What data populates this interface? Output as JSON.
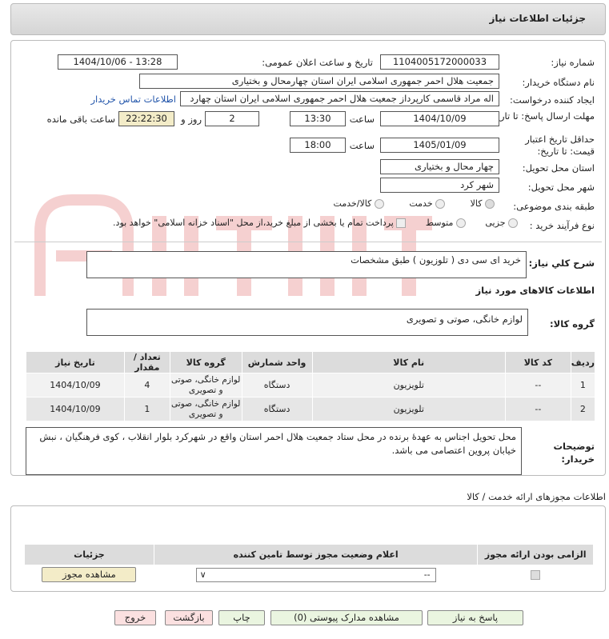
{
  "header": {
    "title": "جزئیات اطلاعات نیاز"
  },
  "fields": {
    "need_number_label": "شماره نیاز:",
    "need_number": "1104005172000033",
    "announce_label": "تاریخ و ساعت اعلان عمومی:",
    "announce_value": "1404/10/06 - 13:28",
    "buyer_org_label": "نام دستگاه خریدار:",
    "buyer_org": "جمعیت هلال احمر جمهوری اسلامی ایران استان چهارمحال و بختیاری",
    "creator_label": "ایجاد کننده درخواست:",
    "creator": "اله مراد قاسمی کارپرداز جمعیت هلال احمر جمهوری اسلامی ایران استان چهارد",
    "contact_link": "اطلاعات تماس خریدار",
    "deadline_label": "مهلت ارسال پاسخ: تا تاریخ:",
    "deadline_date": "1404/10/09",
    "time_label": "ساعت",
    "deadline_time": "13:30",
    "days_value": "2",
    "days_label": "روز و",
    "remaining_time": "22:22:30",
    "remaining_label": "ساعت باقی مانده",
    "validity_label": "حداقل تاریخ اعتبار قیمت: تا تاریخ:",
    "validity_date": "1405/01/09",
    "validity_time": "18:00",
    "province_label": "استان محل تحویل:",
    "province": "چهار محال و بختیاری",
    "city_label": "شهر محل تحویل:",
    "city": "شهر کرد",
    "category_label": "طبقه بندی موضوعی:",
    "category_options": [
      "کالا",
      "خدمت",
      "کالا/خدمت"
    ],
    "process_label": "نوع فرآیند خرید :",
    "process_options": [
      "جزیی",
      "متوسط"
    ],
    "payment_note": "پرداخت تمام یا بخشی از مبلغ خرید،از محل \"اسناد خزانه اسلامی\" خواهد بود."
  },
  "summary": {
    "label": "شرح کلي نياز:",
    "value": "خرید ای سی دی ( تلوزیون ) طبق مشخصات"
  },
  "goods_section": {
    "title": "اطلاعات کالاهای مورد نیاز",
    "group_label": "گروه کالا:",
    "group_value": "لوازم خانگی، صوتی و تصویری"
  },
  "table": {
    "headers": [
      "ردیف",
      "کد کالا",
      "نام کالا",
      "واحد شمارش",
      "گروه کالا",
      "تعداد / مقدار",
      "تاریخ نیاز"
    ],
    "rows": [
      [
        "1",
        "--",
        "تلویزیون",
        "دستگاه",
        "لوازم خانگی، صوتی و تصویری",
        "4",
        "1404/10/09"
      ],
      [
        "2",
        "--",
        "تلویزیون",
        "دستگاه",
        "لوازم خانگی، صوتی و تصویری",
        "1",
        "1404/10/09"
      ]
    ]
  },
  "buyer_notes": {
    "label": "توضیحات خریدار:",
    "value": "محل تحویل اجناس به عهدهٔ برنده در محل ستاد جمعیت هلال احمر استان واقع در شهرکرد بلوار انقلاب ، کوی فرهنگیان ، نبش خیابان پروین اعتصامی می باشد."
  },
  "permits": {
    "title": "اطلاعات مجوزهای ارائه خدمت / کالا",
    "headers": [
      "الزامی بودن ارائه مجوز",
      "اعلام وضعیت مجوز توسط تامین کننده",
      "جزئیات"
    ],
    "select_value": "--",
    "view_button": "مشاهده مجوز"
  },
  "buttons": {
    "reply": "پاسخ به نیاز",
    "docs": "مشاهده مدارک پیوستی (0)",
    "print": "چاپ",
    "back": "بازگشت",
    "exit": "خروج"
  }
}
